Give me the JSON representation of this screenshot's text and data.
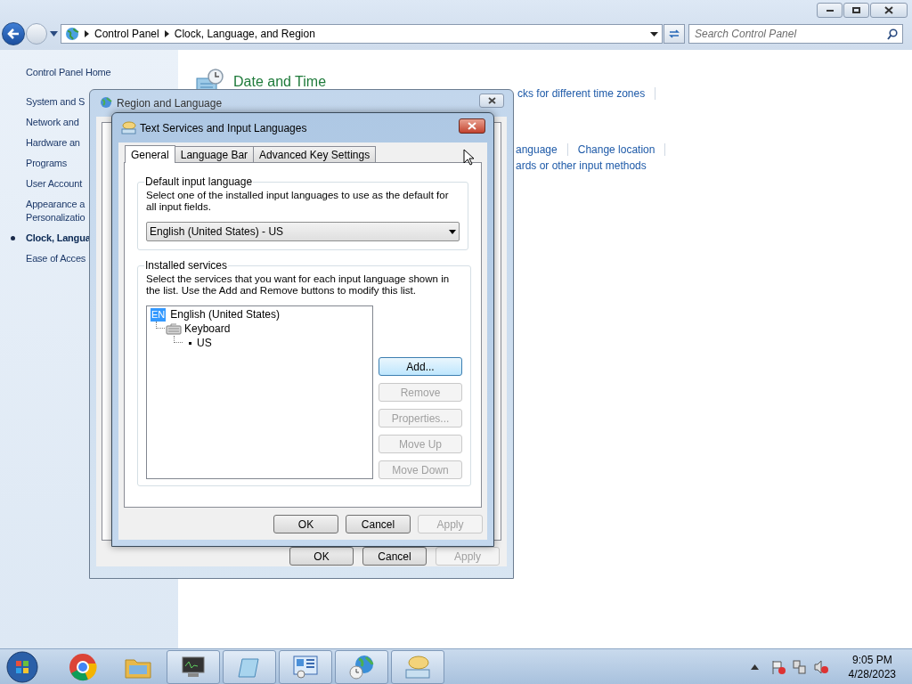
{
  "address_bar": {
    "breadcrumbs": [
      "Control Panel",
      "Clock, Language, and Region"
    ]
  },
  "search": {
    "placeholder": "Search Control Panel"
  },
  "sidebar": {
    "items": [
      {
        "label": "Control Panel Home",
        "selected": false
      },
      {
        "label": "System and S",
        "selected": false
      },
      {
        "label": "Network and",
        "selected": false
      },
      {
        "label": "Hardware an",
        "selected": false
      },
      {
        "label": "Programs",
        "selected": false
      },
      {
        "label": "User Account",
        "selected": false
      },
      {
        "label": "Appearance a",
        "selected": false
      },
      {
        "label": "Personalizatio",
        "selected": false
      },
      {
        "label": "Clock, Langua",
        "selected": true
      },
      {
        "label": "Ease of Acces",
        "selected": false
      }
    ]
  },
  "content": {
    "heading": "Date and Time",
    "link_rows": [
      {
        "links": [
          "cks for different time zones"
        ],
        "separators": true
      },
      {
        "links": [
          "anguage",
          "Change location"
        ],
        "separators": true
      },
      {
        "links": [
          "ards or other input methods"
        ],
        "separators": false
      }
    ]
  },
  "region_dialog": {
    "title": "Region and Language",
    "buttons": [
      {
        "label": "OK",
        "disabled": false
      },
      {
        "label": "Cancel",
        "disabled": false
      },
      {
        "label": "Apply",
        "disabled": true
      }
    ]
  },
  "text_services_dialog": {
    "title": "Text Services and Input Languages",
    "tabs": [
      {
        "label": "General",
        "selected": true
      },
      {
        "label": "Language Bar",
        "selected": false
      },
      {
        "label": "Advanced Key Settings",
        "selected": false
      }
    ],
    "default_input_language": {
      "group_title": "Default input language",
      "description": "Select one of the installed input languages to use as the default for all input fields.",
      "value": "English (United States) - US"
    },
    "installed_services": {
      "group_title": "Installed services",
      "description": "Select the services that you want for each input language shown in the list. Use the Add and Remove buttons to modify this list.",
      "tree": [
        {
          "kind": "language",
          "badge": "EN",
          "label": "English (United States)",
          "children": [
            {
              "kind": "category",
              "label": "Keyboard",
              "children": [
                {
                  "kind": "service",
                  "label": "US"
                }
              ]
            }
          ]
        }
      ],
      "buttons": [
        {
          "label": "Add...",
          "disabled": false
        },
        {
          "label": "Remove",
          "disabled": true
        },
        {
          "label": "Properties...",
          "disabled": true
        },
        {
          "label": "Move Up",
          "disabled": true
        },
        {
          "label": "Move Down",
          "disabled": true
        }
      ]
    },
    "buttons": [
      {
        "label": "OK",
        "disabled": false
      },
      {
        "label": "Cancel",
        "disabled": false
      },
      {
        "label": "Apply",
        "disabled": true
      }
    ]
  },
  "taskbar": {
    "clock": {
      "time": "9:05 PM",
      "date": "4/28/2023"
    }
  }
}
